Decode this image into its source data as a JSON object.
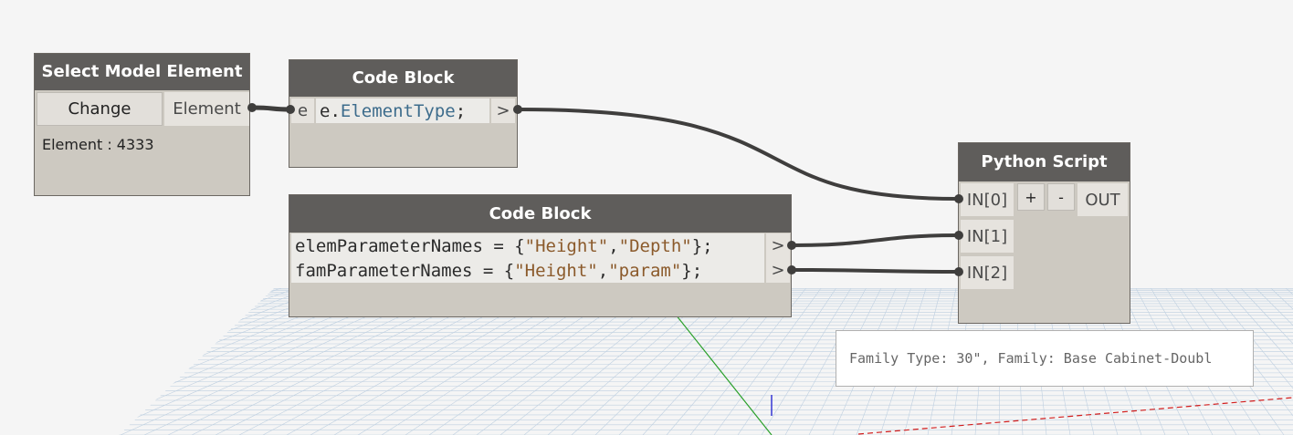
{
  "colors": {
    "node_header": "#5f5d5b",
    "node_body": "#cdc9c1",
    "wire": "#3f3e3d",
    "keyword": "#3d6c8c",
    "string": "#8b5a2b",
    "grid": "#a8c0d8",
    "axis_red": "#d21e1e",
    "axis_green": "#2aa02a",
    "axis_blue": "#2a2ad2"
  },
  "nodes": {
    "select_model_element": {
      "title": "Select Model Element",
      "change_button": "Change",
      "output_port": "Element",
      "status_text": "Element : 4333"
    },
    "code_block_1": {
      "title": "Code Block",
      "input_port": "e",
      "code_var": "e.",
      "code_keyword": "ElementType",
      "code_end": ";",
      "output_port": ">"
    },
    "code_block_2": {
      "title": "Code Block",
      "lines": [
        {
          "name": "elemParameterNames",
          "op": " = {",
          "str1": "\"Height\"",
          "sep": ",",
          "str2": "\"Depth\"",
          "end": "};",
          "output_port": ">"
        },
        {
          "name": "famParameterNames",
          "op": " = {",
          "str1": "\"Height\"",
          "sep": ",",
          "str2": "\"param\"",
          "end": "};",
          "output_port": ">"
        }
      ]
    },
    "python_script": {
      "title": "Python Script",
      "inputs": [
        "IN[0]",
        "IN[1]",
        "IN[2]"
      ],
      "add_button": "+",
      "remove_button": "-",
      "output_port": "OUT"
    }
  },
  "tooltip": {
    "text": "Family Type: 30\", Family: Base Cabinet-Doubl"
  }
}
